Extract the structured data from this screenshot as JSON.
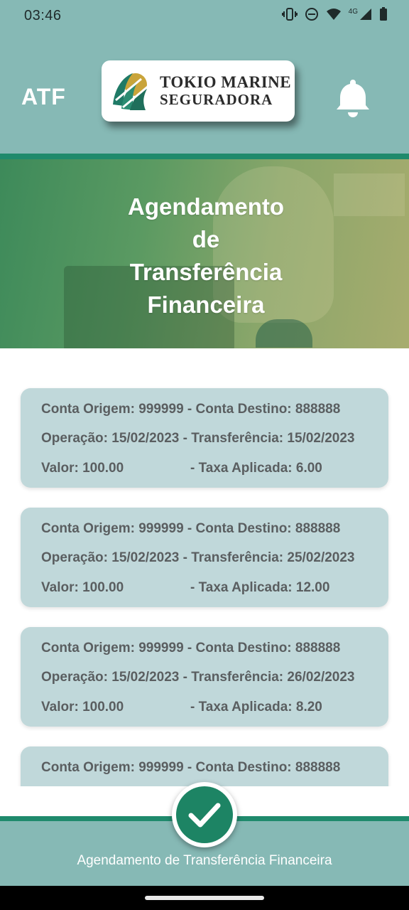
{
  "status_bar": {
    "time": "03:46",
    "network": "4G",
    "icons": [
      "vibrate-icon",
      "do-not-disturb-icon",
      "wifi-icon",
      "cell-signal-icon",
      "battery-icon"
    ]
  },
  "header": {
    "app_abbr": "ATF",
    "logo_line1": "TOKIO MARINE",
    "logo_line2": "SEGURADORA",
    "bell_icon": "bell-icon"
  },
  "banner": {
    "title_lines": [
      "Agendamento",
      "de",
      "Transferência",
      "Financeira"
    ]
  },
  "transfers": [
    {
      "origem_destino": "Conta Origem: 999999 - Conta Destino: 888888",
      "datas": "Operação: 15/02/2023 - Transferência: 15/02/2023",
      "valor": "Valor: 100.00",
      "taxa": "- Taxa Aplicada: 6.00"
    },
    {
      "origem_destino": "Conta Origem: 999999 - Conta Destino: 888888",
      "datas": "Operação: 15/02/2023 - Transferência: 25/02/2023",
      "valor": "Valor: 100.00",
      "taxa": "- Taxa Aplicada: 12.00"
    },
    {
      "origem_destino": "Conta Origem: 999999 - Conta Destino: 888888",
      "datas": "Operação: 15/02/2023 - Transferência: 26/02/2023",
      "valor": "Valor: 100.00",
      "taxa": "- Taxa Aplicada: 8.20"
    },
    {
      "origem_destino": "Conta Origem: 999999 - Conta Destino: 888888"
    }
  ],
  "bottom": {
    "label": "Agendamento de Transferência Financeira",
    "fab_icon": "checkmark-icon"
  },
  "colors": {
    "header_bg": "#86b9b5",
    "accent_green": "#1f8a6c",
    "card_bg": "#c0d8da",
    "fab_green": "#1d8464"
  }
}
